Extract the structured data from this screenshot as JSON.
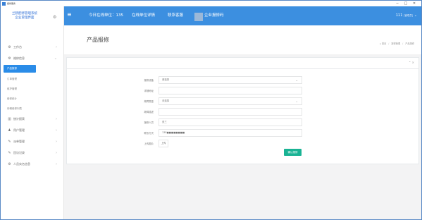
{
  "window": {
    "title": "报修服务",
    "minimize_label": "─",
    "maximize_label": "□",
    "close_label": "✕"
  },
  "sidebar": {
    "logo_line1": "兰鹤配修管理系统",
    "logo_line2": "企业管理界面",
    "settings_icon": "gear-icon",
    "items": [
      {
        "label": "工作台",
        "icon": "cogs-icon"
      },
      {
        "label": "维修信息",
        "icon": "cogs-icon",
        "children": [
          {
            "label": "产品报修",
            "active": true
          },
          {
            "label": "订单管理"
          },
          {
            "label": "维护管理"
          },
          {
            "label": "维修统计"
          },
          {
            "label": "待确维修列表"
          }
        ]
      },
      {
        "label": "统计报表",
        "icon": "chart-icon"
      },
      {
        "label": "用户管理",
        "icon": "user-icon"
      },
      {
        "label": "派单管理",
        "icon": "edit-icon"
      },
      {
        "label": "回访记录",
        "icon": "edit-icon"
      },
      {
        "label": "人员实名信息",
        "icon": "cogs-icon"
      }
    ]
  },
  "header": {
    "menu_icon": "menu-icon",
    "online_label": "今日在线单位：135",
    "details_link": "在线单位详情",
    "contact_link": "联系客服",
    "company_label": "企业报修码",
    "user_name": "111",
    "user_role": "[管理员]",
    "accent_color": "#3c8fe0"
  },
  "page": {
    "title": "产品报修",
    "breadcrumb": [
      "首页",
      "报修管理",
      "产品报修"
    ]
  },
  "form": {
    "fields": [
      {
        "label": "报修设备",
        "value": "请选择",
        "type": "select"
      },
      {
        "label": "详细地址",
        "value": "",
        "type": "text"
      },
      {
        "label": "故障类型",
        "value": "未选择",
        "type": "select"
      },
      {
        "label": "故障描述",
        "value": "",
        "type": "text"
      },
      {
        "label": "报修人员",
        "value": "张三",
        "type": "text"
      },
      {
        "label": "联系方式",
        "value": "138■■■■■■■■",
        "type": "text"
      },
      {
        "label": "上传图片",
        "value": "上传",
        "type": "upload"
      }
    ],
    "submit_label": "确认报修",
    "submit_color": "#1ab394"
  }
}
